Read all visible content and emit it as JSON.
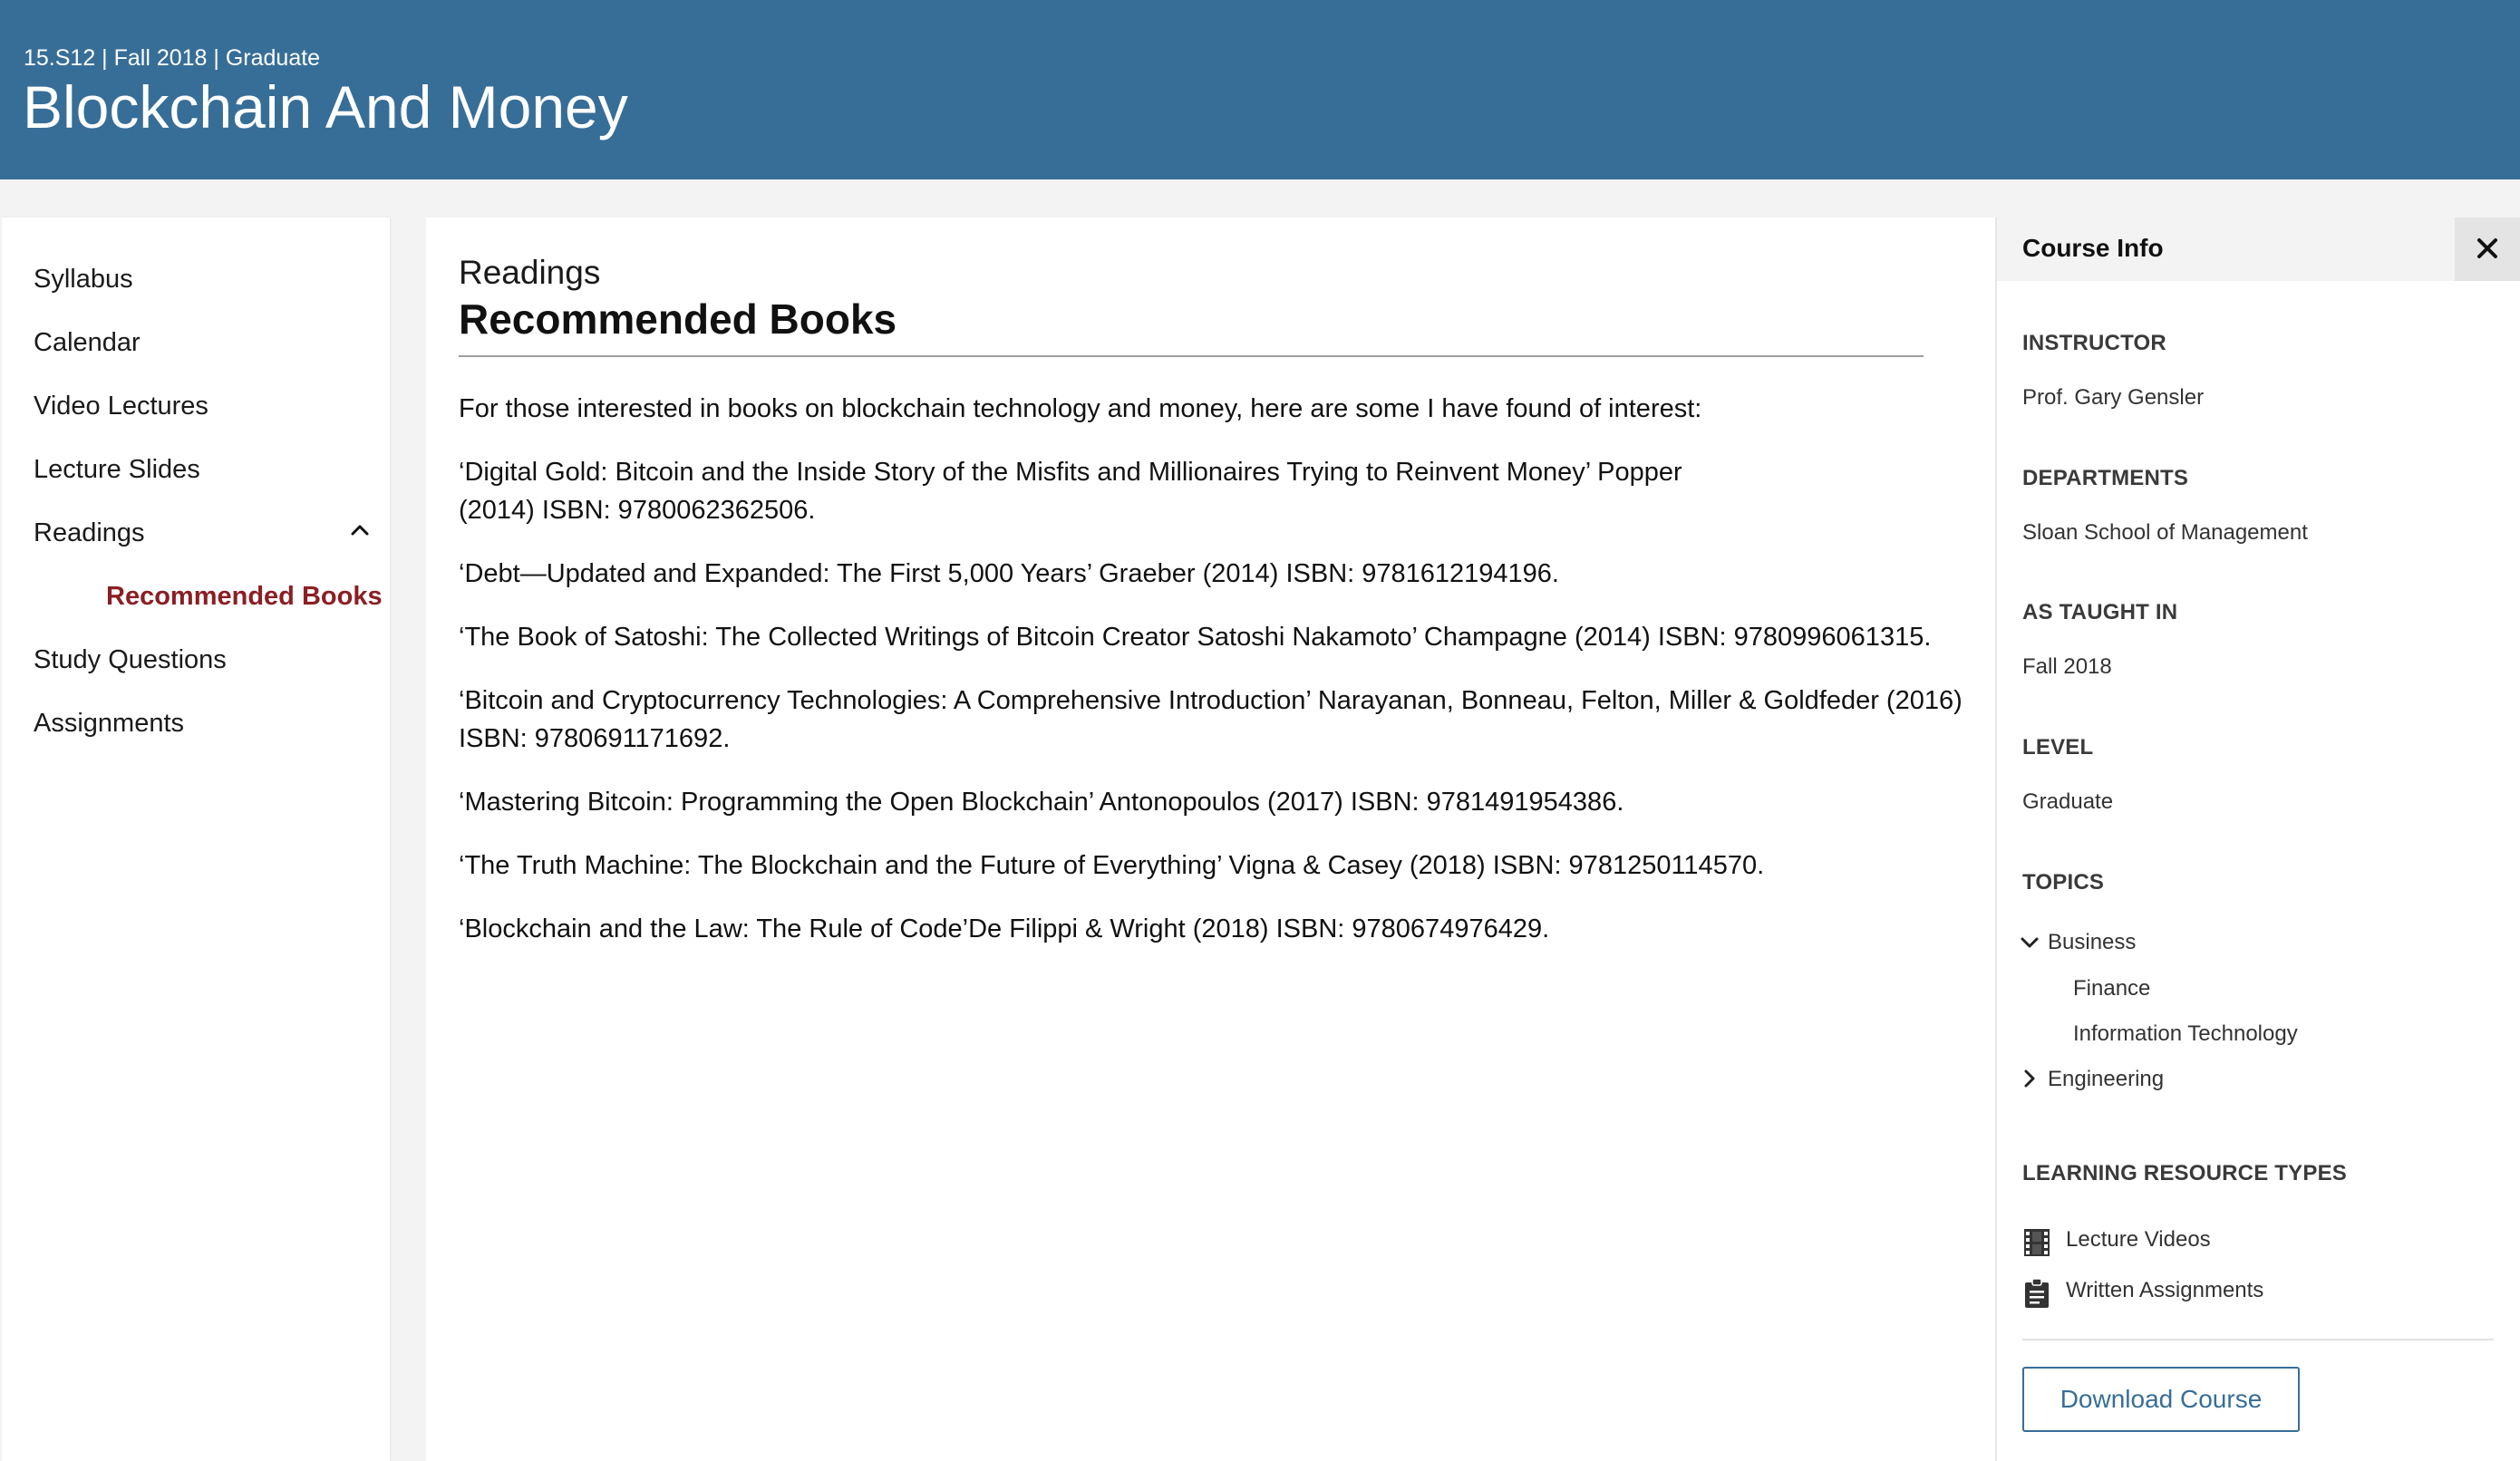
{
  "header": {
    "meta": "15.S12 | Fall 2018 | Graduate",
    "title": "Blockchain And Money"
  },
  "nav": {
    "items": [
      {
        "label": "Syllabus"
      },
      {
        "label": "Calendar"
      },
      {
        "label": "Video Lectures"
      },
      {
        "label": "Lecture Slides"
      },
      {
        "label": "Readings",
        "expanded": true
      },
      {
        "label": "Study Questions"
      },
      {
        "label": "Assignments"
      }
    ],
    "sub_items": [
      {
        "label": "Recommended Books",
        "active": true
      }
    ],
    "active_color": "#8a1f24"
  },
  "main": {
    "breadcrumb": "Readings",
    "title": "Recommended Books",
    "intro": "For those interested in books on blockchain technology and money, here are some I have found of interest:",
    "books": [
      " ‘Digital Gold: Bitcoin and the Inside Story of the Misfits and Millionaires Trying to Reinvent Money’ Popper (2014) ISBN: 9780062362506.",
      " ‘Debt—Updated and Expanded: The First 5,000 Years’ Graeber (2014) ISBN: 9781612194196.",
      " ‘The Book of Satoshi: The Collected Writings of Bitcoin Creator Satoshi Nakamoto’ Champagne (2014) ISBN: 9780996061315.",
      " ‘Bitcoin and Cryptocurrency Technologies: A Comprehensive Introduction’ Narayanan, Bonneau, Felton, Miller & Goldfeder (2016) ISBN: 9780691171692.",
      " ‘Mastering Bitcoin: Programming the Open Blockchain’ Antonopoulos (2017) ISBN: 9781491954386.",
      " ‘The Truth Machine: The Blockchain and the Future of Everything’ Vigna & Casey (2018) ISBN: 9781250114570.",
      " ‘Blockchain and the Law: The Rule of Code’De Filippi & Wright (2018) ISBN: 9780674976429."
    ]
  },
  "course_info": {
    "heading": "Course Info",
    "close_icon": "close-icon",
    "instructor_label": "INSTRUCTOR",
    "instructor": "Prof. Gary Gensler",
    "departments_label": "DEPARTMENTS",
    "department": "Sloan School of Management",
    "taught_label": "AS TAUGHT IN",
    "taught": "Fall 2018",
    "level_label": "LEVEL",
    "level": "Graduate",
    "topics_label": "TOPICS",
    "topics": [
      {
        "label": "Business",
        "expanded": true,
        "children": [
          {
            "label": "Finance"
          },
          {
            "label": "Information Technology"
          }
        ]
      },
      {
        "label": "Engineering",
        "expanded": false
      }
    ],
    "resource_types_label": "LEARNING RESOURCE TYPES",
    "resource_types": [
      {
        "label": "Lecture Videos",
        "icon": "film-icon"
      },
      {
        "label": "Written Assignments",
        "icon": "clipboard-icon"
      }
    ],
    "download_label": "Download Course"
  },
  "colors": {
    "header_bg": "#376e98",
    "accent": "#376e98",
    "active_nav": "#8a1f24"
  }
}
